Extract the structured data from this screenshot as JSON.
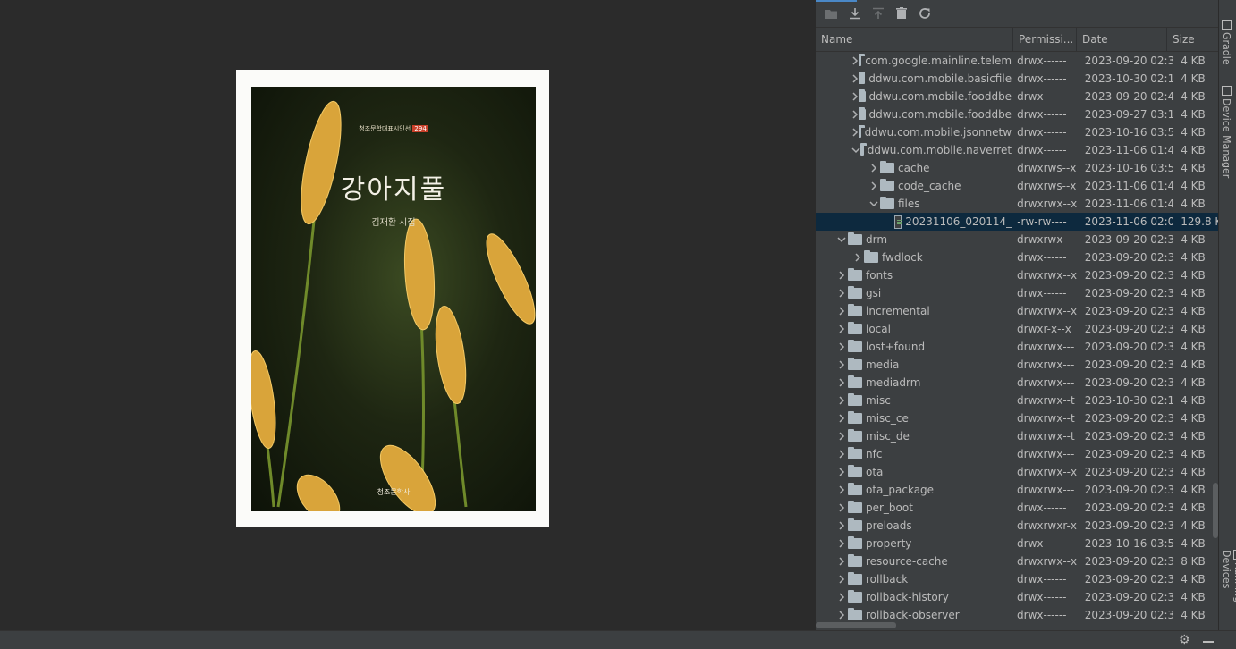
{
  "book": {
    "series": "청조문학대표시인선",
    "series_num": "294",
    "title": "강아지풀",
    "author": "김재환 시집",
    "publisher": "청조문학사"
  },
  "toolbar": {
    "icons": [
      "new-folder-icon",
      "download-icon",
      "upload-icon",
      "delete-icon",
      "refresh-icon"
    ]
  },
  "columns": [
    "Name",
    "Permissi...",
    "Date",
    "Size"
  ],
  "rows": [
    {
      "indent": 2,
      "arrow": ">",
      "type": "folder",
      "name": "com.google.mainline.telem",
      "perm": "drwx------",
      "date": "2023-09-20 02:3",
      "size": "4 KB"
    },
    {
      "indent": 2,
      "arrow": ">",
      "type": "folder",
      "name": "ddwu.com.mobile.basicfile",
      "perm": "drwx------",
      "date": "2023-10-30 02:1",
      "size": "4 KB"
    },
    {
      "indent": 2,
      "arrow": ">",
      "type": "folder",
      "name": "ddwu.com.mobile.fooddbe",
      "perm": "drwx------",
      "date": "2023-09-20 02:4",
      "size": "4 KB"
    },
    {
      "indent": 2,
      "arrow": ">",
      "type": "folder",
      "name": "ddwu.com.mobile.fooddbe",
      "perm": "drwx------",
      "date": "2023-09-27 03:1",
      "size": "4 KB"
    },
    {
      "indent": 2,
      "arrow": ">",
      "type": "folder",
      "name": "ddwu.com.mobile.jsonnetw",
      "perm": "drwx------",
      "date": "2023-10-16 03:5",
      "size": "4 KB"
    },
    {
      "indent": 2,
      "arrow": "v",
      "type": "folder",
      "name": "ddwu.com.mobile.naverret",
      "perm": "drwx------",
      "date": "2023-11-06 01:4",
      "size": "4 KB"
    },
    {
      "indent": 3,
      "arrow": ">",
      "type": "folder",
      "name": "cache",
      "perm": "drwxrws--x",
      "date": "2023-10-16 03:5",
      "size": "4 KB"
    },
    {
      "indent": 3,
      "arrow": ">",
      "type": "folder",
      "name": "code_cache",
      "perm": "drwxrws--x",
      "date": "2023-11-06 01:4",
      "size": "4 KB"
    },
    {
      "indent": 3,
      "arrow": "v",
      "type": "folder",
      "name": "files",
      "perm": "drwxrwx--x",
      "date": "2023-11-06 01:4",
      "size": "4 KB"
    },
    {
      "indent": 4,
      "arrow": "",
      "type": "file",
      "name": "20231106_020114_",
      "perm": "-rw-rw----",
      "date": "2023-11-06 02:0",
      "size": "129.8 K",
      "selected": true
    },
    {
      "indent": 1,
      "arrow": "v",
      "type": "folder",
      "name": "drm",
      "perm": "drwxrwx---",
      "date": "2023-09-20 02:3",
      "size": "4 KB"
    },
    {
      "indent": 2,
      "arrow": ">",
      "type": "folder",
      "name": "fwdlock",
      "perm": "drwx------",
      "date": "2023-09-20 02:3",
      "size": "4 KB"
    },
    {
      "indent": 1,
      "arrow": ">",
      "type": "folder",
      "name": "fonts",
      "perm": "drwxrwx--x",
      "date": "2023-09-20 02:3",
      "size": "4 KB"
    },
    {
      "indent": 1,
      "arrow": ">",
      "type": "folder",
      "name": "gsi",
      "perm": "drwx------",
      "date": "2023-09-20 02:3",
      "size": "4 KB"
    },
    {
      "indent": 1,
      "arrow": ">",
      "type": "folder",
      "name": "incremental",
      "perm": "drwxrwx--x",
      "date": "2023-09-20 02:3",
      "size": "4 KB"
    },
    {
      "indent": 1,
      "arrow": ">",
      "type": "folder",
      "name": "local",
      "perm": "drwxr-x--x",
      "date": "2023-09-20 02:3",
      "size": "4 KB"
    },
    {
      "indent": 1,
      "arrow": ">",
      "type": "folder",
      "name": "lost+found",
      "perm": "drwxrwx---",
      "date": "2023-09-20 02:3",
      "size": "4 KB"
    },
    {
      "indent": 1,
      "arrow": ">",
      "type": "folder",
      "name": "media",
      "perm": "drwxrwx---",
      "date": "2023-09-20 02:3",
      "size": "4 KB"
    },
    {
      "indent": 1,
      "arrow": ">",
      "type": "folder",
      "name": "mediadrm",
      "perm": "drwxrwx---",
      "date": "2023-09-20 02:3",
      "size": "4 KB"
    },
    {
      "indent": 1,
      "arrow": ">",
      "type": "folder",
      "name": "misc",
      "perm": "drwxrwx--t",
      "date": "2023-10-30 02:1",
      "size": "4 KB"
    },
    {
      "indent": 1,
      "arrow": ">",
      "type": "folder",
      "name": "misc_ce",
      "perm": "drwxrwx--t",
      "date": "2023-09-20 02:3",
      "size": "4 KB"
    },
    {
      "indent": 1,
      "arrow": ">",
      "type": "folder",
      "name": "misc_de",
      "perm": "drwxrwx--t",
      "date": "2023-09-20 02:3",
      "size": "4 KB"
    },
    {
      "indent": 1,
      "arrow": ">",
      "type": "folder",
      "name": "nfc",
      "perm": "drwxrwx---",
      "date": "2023-09-20 02:3",
      "size": "4 KB"
    },
    {
      "indent": 1,
      "arrow": ">",
      "type": "folder",
      "name": "ota",
      "perm": "drwxrwx--x",
      "date": "2023-09-20 02:3",
      "size": "4 KB"
    },
    {
      "indent": 1,
      "arrow": ">",
      "type": "folder",
      "name": "ota_package",
      "perm": "drwxrwx---",
      "date": "2023-09-20 02:3",
      "size": "4 KB"
    },
    {
      "indent": 1,
      "arrow": ">",
      "type": "folder",
      "name": "per_boot",
      "perm": "drwx------",
      "date": "2023-09-20 02:3",
      "size": "4 KB"
    },
    {
      "indent": 1,
      "arrow": ">",
      "type": "folder",
      "name": "preloads",
      "perm": "drwxrwxr-x",
      "date": "2023-09-20 02:3",
      "size": "4 KB"
    },
    {
      "indent": 1,
      "arrow": ">",
      "type": "folder",
      "name": "property",
      "perm": "drwx------",
      "date": "2023-10-16 03:5",
      "size": "4 KB"
    },
    {
      "indent": 1,
      "arrow": ">",
      "type": "folder",
      "name": "resource-cache",
      "perm": "drwxrwx--x",
      "date": "2023-09-20 02:3",
      "size": "8 KB"
    },
    {
      "indent": 1,
      "arrow": ">",
      "type": "folder",
      "name": "rollback",
      "perm": "drwx------",
      "date": "2023-09-20 02:3",
      "size": "4 KB"
    },
    {
      "indent": 1,
      "arrow": ">",
      "type": "folder",
      "name": "rollback-history",
      "perm": "drwx------",
      "date": "2023-09-20 02:3",
      "size": "4 KB"
    },
    {
      "indent": 1,
      "arrow": ">",
      "type": "folder",
      "name": "rollback-observer",
      "perm": "drwx------",
      "date": "2023-09-20 02:3",
      "size": "4 KB"
    }
  ],
  "sidebar": {
    "gradle": "Gradle",
    "device_manager": "Device Manager",
    "running_devices": "Running Devices"
  }
}
